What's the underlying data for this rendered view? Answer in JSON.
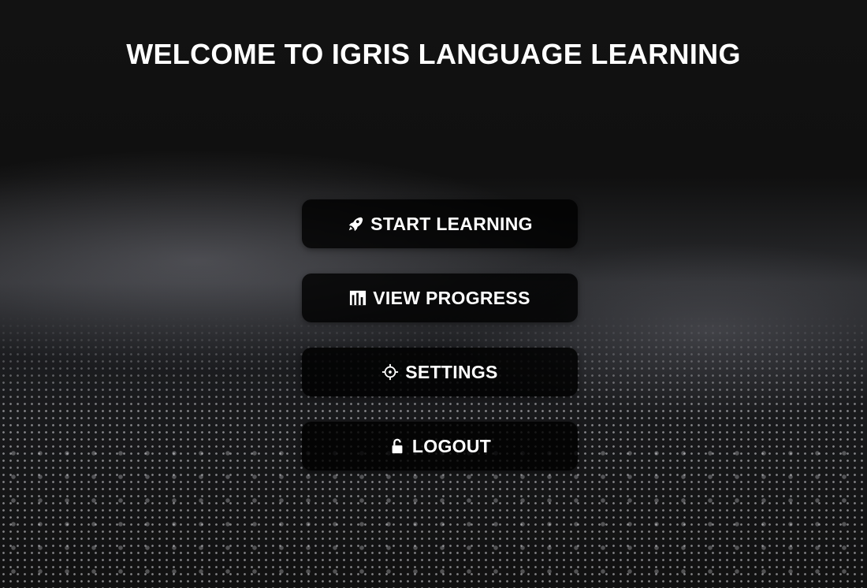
{
  "title": "WELCOME TO IGRIS LANGUAGE LEARNING",
  "menu": [
    {
      "label": "START LEARNING",
      "icon": "rocket-icon"
    },
    {
      "label": "VIEW PROGRESS",
      "icon": "bar-chart-icon"
    },
    {
      "label": "SETTINGS",
      "icon": "gear-icon"
    },
    {
      "label": "LOGOUT",
      "icon": "unlock-icon"
    }
  ]
}
